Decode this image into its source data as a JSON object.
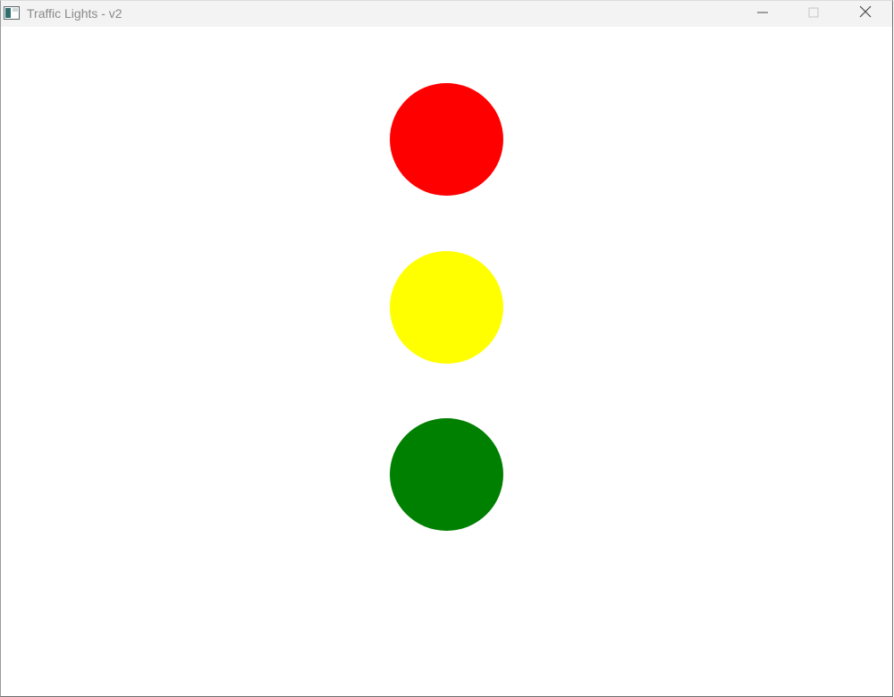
{
  "window": {
    "title": "Traffic Lights - v2",
    "icon": "app-window-icon",
    "controls": {
      "minimize_icon": "minimize-icon",
      "maximize_icon": "maximize-icon",
      "close_icon": "close-icon"
    }
  },
  "lights": [
    {
      "name": "red",
      "color": "#ff0000"
    },
    {
      "name": "yellow",
      "color": "#ffff00"
    },
    {
      "name": "green",
      "color": "#008000"
    }
  ],
  "colors": {
    "titlebar_bg": "#f3f3f3",
    "client_bg": "#ffffff",
    "title_text": "#8a8a8a"
  }
}
